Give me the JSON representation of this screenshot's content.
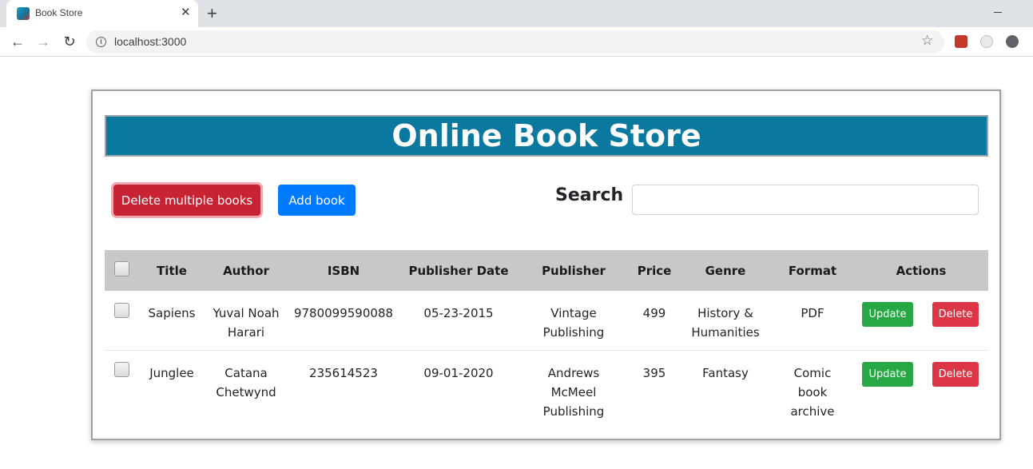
{
  "browser": {
    "tab_title": "Book Store",
    "tab_close": "✕",
    "new_tab": "+",
    "url": "localhost:3000",
    "icons": {
      "back": "←",
      "forward": "→",
      "reload": "↻",
      "info": "i",
      "star": "☆"
    }
  },
  "page": {
    "banner_title": "Online Book Store",
    "delete_multiple_label": "Delete multiple books",
    "add_book_label": "Add book",
    "search_label": "Search",
    "search_value": ""
  },
  "table": {
    "headers": {
      "title": "Title",
      "author": "Author",
      "isbn": "ISBN",
      "publisher_date": "Publisher Date",
      "publisher": "Publisher",
      "price": "Price",
      "genre": "Genre",
      "format": "Format",
      "actions": "Actions"
    },
    "rows": [
      {
        "title": "Sapiens",
        "author_1": "Yuval Noah",
        "author_2": "Harari",
        "isbn": "9780099590088",
        "date": "05-23-2015",
        "publisher_1": "Vintage",
        "publisher_2": "Publishing",
        "publisher_3": "",
        "price": "499",
        "genre_1": "History &",
        "genre_2": "Humanities",
        "format_1": "PDF",
        "format_2": "",
        "format_3": "",
        "update_label": "Update",
        "delete_label": "Delete"
      },
      {
        "title": "Junglee",
        "author_1": "Catana",
        "author_2": "Chetwynd",
        "isbn": "235614523",
        "date": "09-01-2020",
        "publisher_1": "Andrews",
        "publisher_2": "McMeel",
        "publisher_3": "Publishing",
        "price": "395",
        "genre_1": "Fantasy",
        "genre_2": "",
        "format_1": "Comic",
        "format_2": "book",
        "format_3": "archive",
        "update_label": "Update",
        "delete_label": "Delete"
      }
    ]
  },
  "colors": {
    "banner": "#0a789f",
    "danger": "#dc3545",
    "primary": "#007bff",
    "success": "#28a745",
    "header_bg": "#c8c8c8"
  }
}
